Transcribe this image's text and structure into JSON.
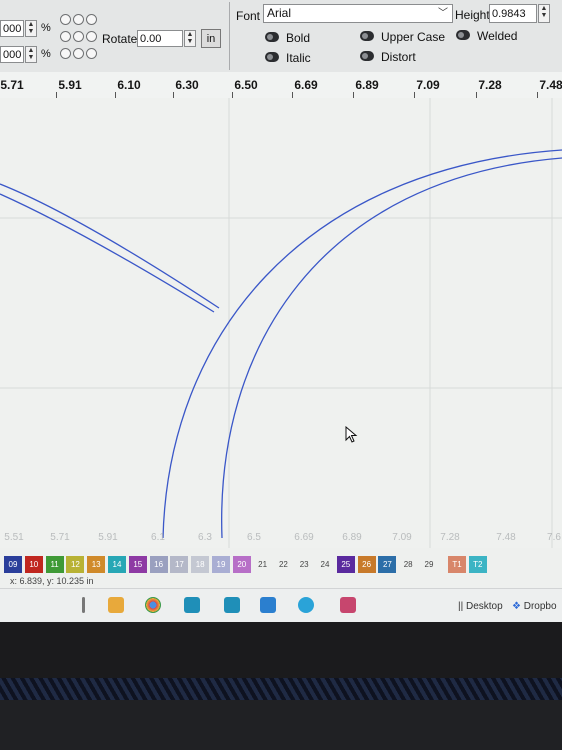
{
  "toolbar": {
    "scale_x_value": "000",
    "scale_y_value": "000",
    "percent_symbol": "%",
    "rotate_label": "Rotate",
    "rotate_value": "0.00",
    "unit_button_label": "in",
    "font_label": "Font",
    "font_value": "Arial",
    "height_label": "Height",
    "height_value": "0.9843",
    "options": {
      "bold": "Bold",
      "italic": "Italic",
      "upper_case": "Upper Case",
      "distort": "Distort",
      "welded": "Welded"
    }
  },
  "ruler": {
    "ticks": [
      "5.71",
      "5.91",
      "6.10",
      "6.30",
      "6.50",
      "6.69",
      "6.89",
      "7.09",
      "7.28",
      "7.48"
    ]
  },
  "bottom_ruler": {
    "ticks": [
      "5.51",
      "5.71",
      "5.91",
      "6.1",
      "6.3",
      "6.5",
      "6.69",
      "6.89",
      "7.09",
      "7.28",
      "7.48",
      "7.6"
    ]
  },
  "palette": {
    "swatches": [
      {
        "label": "09",
        "color": "#2a3e9a"
      },
      {
        "label": "10",
        "color": "#c0271f"
      },
      {
        "label": "11",
        "color": "#3f9a36"
      },
      {
        "label": "12",
        "color": "#b8b234"
      },
      {
        "label": "13",
        "color": "#d08a2a"
      },
      {
        "label": "14",
        "color": "#27a7b5"
      },
      {
        "label": "15",
        "color": "#8e3aa4"
      },
      {
        "label": "16",
        "color": "#9aa0bf"
      },
      {
        "label": "17",
        "color": "#b4b8c8"
      },
      {
        "label": "18",
        "color": "#c4c8d2"
      },
      {
        "label": "19",
        "color": "#a9aed3"
      },
      {
        "label": "20",
        "color": "#b76fc7"
      },
      {
        "label": "21",
        "color": "#eef0ee"
      },
      {
        "label": "22",
        "color": "#eef0ee"
      },
      {
        "label": "23",
        "color": "#eef0ee"
      },
      {
        "label": "24",
        "color": "#eef0ee"
      },
      {
        "label": "25",
        "color": "#5a2a9e"
      },
      {
        "label": "26",
        "color": "#c87a2a"
      },
      {
        "label": "27",
        "color": "#2c6ea8"
      },
      {
        "label": "28",
        "color": "#eef0ee"
      },
      {
        "label": "29",
        "color": "#eef0ee"
      },
      {
        "label": "T1",
        "color": "#d8866a"
      },
      {
        "label": "T2",
        "color": "#3cb4c4"
      }
    ]
  },
  "status": {
    "coords": "x: 6.839, y: 10.235 in"
  },
  "taskbar": {
    "desktop_label": "Desktop",
    "dropbox_label": "Dropbo"
  },
  "colors": {
    "curve": "#3a57c8",
    "toolbar_bg": "#e4e6e6",
    "canvas_bg": "#eff1ef"
  }
}
